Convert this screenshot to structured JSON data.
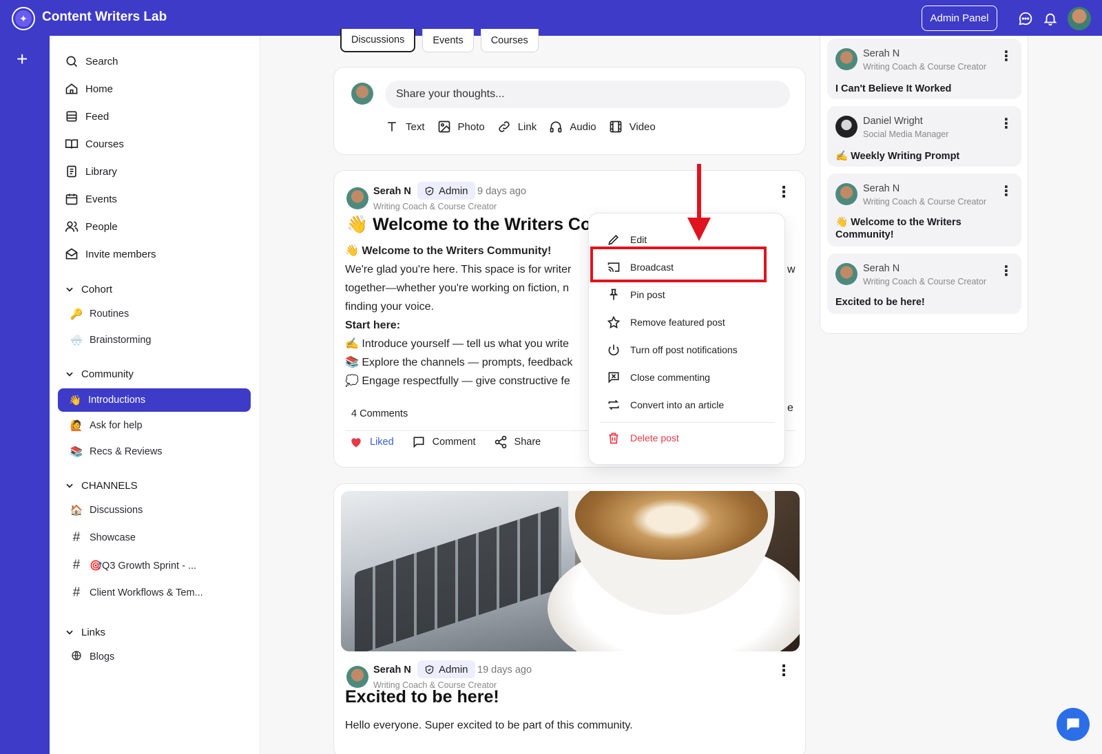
{
  "app": {
    "title": "Content Writers Lab",
    "admin_button": "Admin Panel"
  },
  "sidebar": {
    "nav": [
      {
        "label": "Search",
        "icon": "search-icon"
      },
      {
        "label": "Home",
        "icon": "home-icon"
      },
      {
        "label": "Feed",
        "icon": "feed-icon"
      },
      {
        "label": "Courses",
        "icon": "book-icon"
      },
      {
        "label": "Library",
        "icon": "library-icon"
      },
      {
        "label": "Events",
        "icon": "calendar-icon"
      },
      {
        "label": "People",
        "icon": "people-icon"
      },
      {
        "label": "Invite members",
        "icon": "mail-icon"
      }
    ],
    "cohort": {
      "heading": "Cohort",
      "items": [
        {
          "emoji": "🔑",
          "label": "Routines"
        },
        {
          "emoji": "🌨️",
          "label": "Brainstorming"
        }
      ]
    },
    "community": {
      "heading": "Community",
      "active": {
        "emoji": "👋",
        "label": "Introductions"
      },
      "items": [
        {
          "emoji": "🙋",
          "label": "Ask for help"
        },
        {
          "emoji": "📚",
          "label": "Recs & Reviews"
        }
      ]
    },
    "channels": {
      "heading": "CHANNELS",
      "items": [
        {
          "prefix": "🏠",
          "label": "Discussions"
        },
        {
          "prefix": "#",
          "label": "Showcase"
        },
        {
          "prefix": "#",
          "label": "🎯Q3 Growth Sprint - ..."
        },
        {
          "prefix": "#",
          "label": "Client Workflows & Tem..."
        }
      ]
    },
    "links": {
      "heading": "Links",
      "items": [
        {
          "label": "Blogs"
        }
      ]
    }
  },
  "tabs": [
    "Discussions",
    "Events",
    "Courses"
  ],
  "composer": {
    "placeholder": "Share your thoughts...",
    "actions": [
      {
        "label": "Text"
      },
      {
        "label": "Photo"
      },
      {
        "label": "Link"
      },
      {
        "label": "Audio"
      },
      {
        "label": "Video"
      }
    ]
  },
  "post1": {
    "author": "Serah N",
    "badge": "Admin",
    "time": "9 days ago",
    "role": "Writing Coach & Course Creator",
    "title": "👋 Welcome to the Writers Co",
    "lines": [
      "👋 Welcome to the Writers Community!",
      "We're glad you're here. This space is for writer",
      "together—whether you're working on fiction, n",
      "finding your voice.",
      "Start here:",
      "✍️ Introduce yourself — tell us what you write",
      "📚 Explore the channels — prompts, feedback",
      "💭 Engage respectfully — give constructive fe"
    ],
    "right_fragment_1": "w",
    "right_fragment_2": "e",
    "comments": "4 Comments",
    "actions": {
      "liked": "Liked",
      "comment": "Comment",
      "share": "Share"
    }
  },
  "menu": {
    "items": [
      {
        "label": "Edit",
        "icon": "pencil-icon"
      },
      {
        "label": "Broadcast",
        "icon": "cast-icon"
      },
      {
        "label": "Pin post",
        "icon": "pin-icon"
      },
      {
        "label": "Remove featured post",
        "icon": "star-icon"
      },
      {
        "label": "Turn off post notifications",
        "icon": "power-icon"
      },
      {
        "label": "Close commenting",
        "icon": "close-comment-icon"
      },
      {
        "label": "Convert into an article",
        "icon": "convert-icon"
      }
    ],
    "danger": {
      "label": "Delete post",
      "icon": "trash-icon"
    }
  },
  "post2": {
    "author": "Serah N",
    "badge": "Admin",
    "time": "19 days ago",
    "role": "Writing Coach & Course Creator",
    "title": "Excited to be here!",
    "body": "Hello everyone. Super excited to be part of this community."
  },
  "right_panel": {
    "cards": [
      {
        "name": "Serah N",
        "role": "Writing Coach & Course Creator",
        "title": "I Can't Believe It Worked"
      },
      {
        "name": "Daniel Wright",
        "role": "Social Media Manager",
        "title": "✍️ Weekly Writing Prompt"
      },
      {
        "name": "Serah N",
        "role": "Writing Coach & Course Creator",
        "title": "👋 Welcome to the Writers Community!"
      },
      {
        "name": "Serah N",
        "role": "Writing Coach & Course Creator",
        "title": "Excited to be here!"
      }
    ]
  },
  "colors": {
    "brand": "#3d3bc8",
    "danger": "#e53a46",
    "liked": "#3a5bd9",
    "annotation": "#e0141e"
  }
}
